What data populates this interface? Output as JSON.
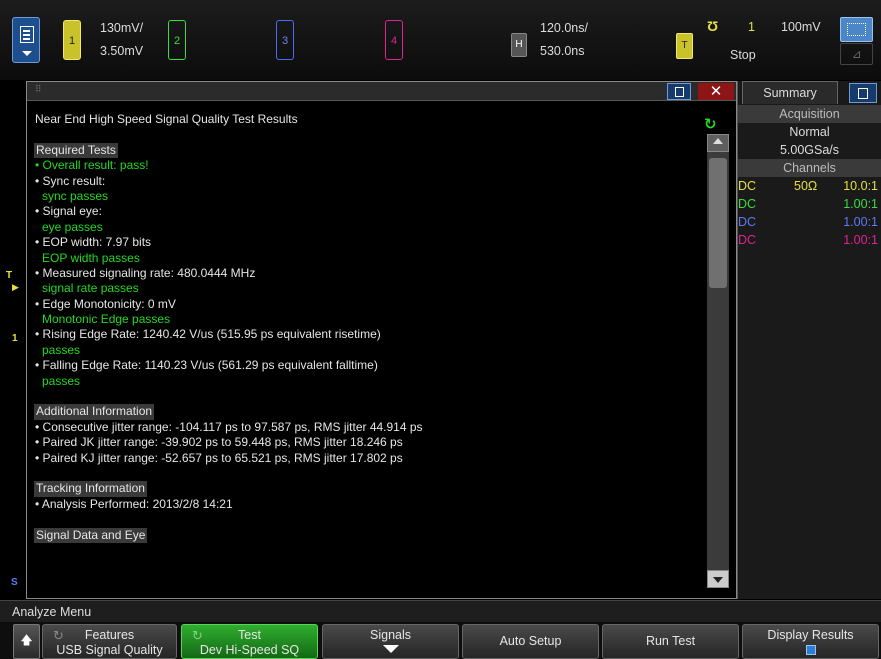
{
  "topbar": {
    "ch1_number": "1",
    "ch2_number": "2",
    "ch3_number": "3",
    "ch4_number": "4",
    "ch1_scale": "130mV/",
    "ch1_offset": "3.50mV",
    "horizontal_label": "H",
    "time_scale": "120.0ns/",
    "time_delay": "530.0ns",
    "trigger_label": "T",
    "trigger_symbol": "Ʊ",
    "trigger_source": "1",
    "trigger_level": "100mV",
    "run_state": "Stop"
  },
  "markers": {
    "trigger_marker": "T",
    "ground_marker": "1",
    "serial_marker": "S"
  },
  "results": {
    "title": "Near End High Speed Signal Quality Test Results",
    "required_heading": "Required Tests",
    "overall": "• Overall result: pass!",
    "sync_label": "• Sync result:",
    "sync_value": "sync passes",
    "eye_label": "• Signal eye:",
    "eye_value": "eye passes",
    "eop_label": "• EOP width: 7.97  bits",
    "eop_value": "EOP width passes",
    "rate_label": "• Measured signaling rate: 480.0444 MHz",
    "rate_value": "signal rate passes",
    "mono_label": "• Edge Monotonicity:  0 mV",
    "mono_value": "Monotonic Edge passes",
    "rise_label": "• Rising Edge Rate: 1240.42  V/us (515.95 ps equivalent risetime)",
    "rise_value": "passes",
    "fall_label": "• Falling Edge Rate: 1140.23  V/us (561.29 ps equivalent falltime)",
    "fall_value": "passes",
    "additional_heading": "Additional Information",
    "jitter_consec": "• Consecutive jitter range: -104.117 ps to 97.587 ps, RMS jitter 44.914 ps",
    "jitter_jk": "• Paired JK jitter range: -39.902 ps to 59.448 ps, RMS jitter 18.246 ps",
    "jitter_kj": "• Paired KJ jitter range: -52.657 ps to 65.521 ps, RMS jitter 17.802 ps",
    "tracking_heading": "Tracking Information",
    "analysis_performed": "• Analysis Performed: 2013/2/8 14:21",
    "signal_heading": "Signal Data and Eye"
  },
  "summary": {
    "tab": "Summary",
    "acq_heading": "Acquisition",
    "acq_mode": "Normal",
    "acq_rate": "5.00GSa/s",
    "channels_heading": "Channels",
    "channels": [
      {
        "coupling": "DC",
        "impedance": "50Ω",
        "probe": "10.0:1",
        "color": "#e6e040"
      },
      {
        "coupling": "DC",
        "impedance": "",
        "probe": "1.00:1",
        "color": "#3ddc3d"
      },
      {
        "coupling": "DC",
        "impedance": "",
        "probe": "1.00:1",
        "color": "#5b7cf5"
      },
      {
        "coupling": "DC",
        "impedance": "",
        "probe": "1.00:1",
        "color": "#e0238f"
      }
    ]
  },
  "menu": {
    "title": "Analyze Menu",
    "back_icon": "up-arrow-icon",
    "features_top": "Features",
    "features_bottom": "USB Signal Quality",
    "test_top": "Test",
    "test_bottom": "Dev Hi-Speed SQ",
    "signals": "Signals",
    "auto_setup": "Auto Setup",
    "run_test": "Run Test",
    "display_results": "Display Results"
  },
  "colors": {
    "pass_green": "#22d822",
    "ch1": "#e6e040",
    "ch2": "#3ddc3d",
    "ch3": "#5b7cf5",
    "ch4": "#e0238f",
    "active_key": "#2fae2f"
  }
}
